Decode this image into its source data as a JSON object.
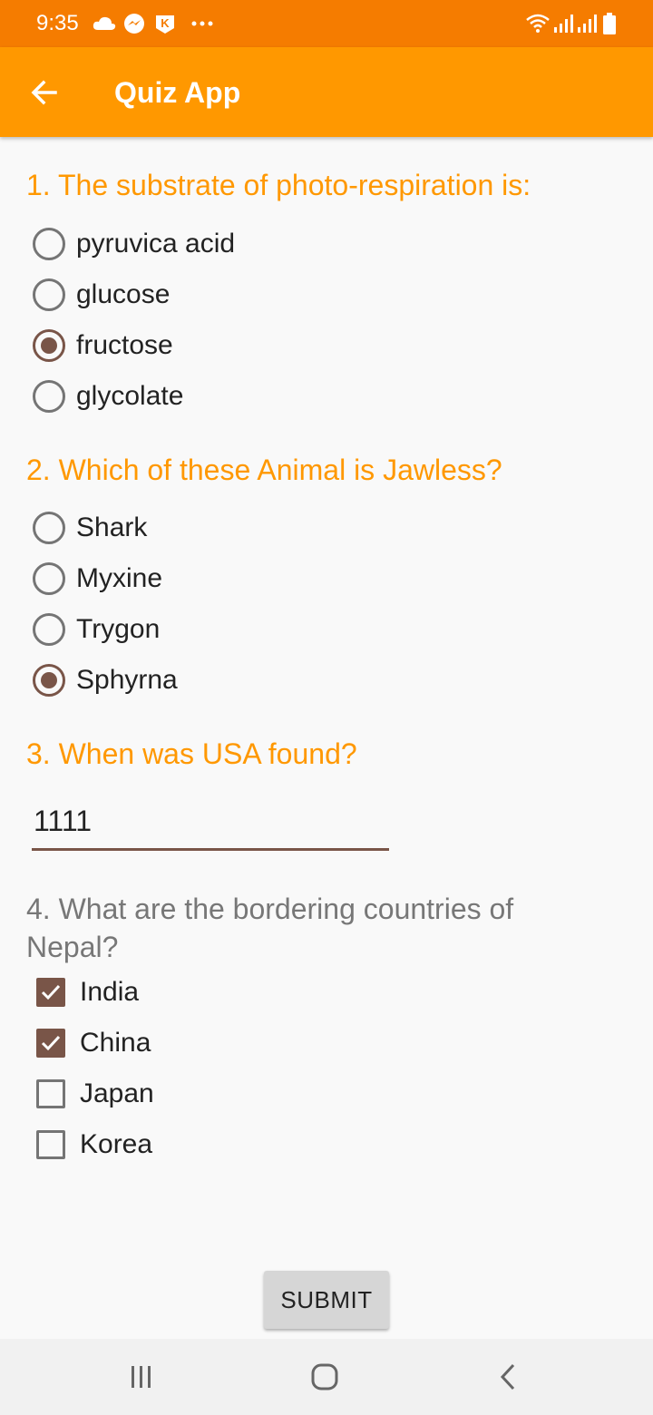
{
  "status_bar": {
    "time": "9:35",
    "left_icons": [
      "cloud-icon",
      "messenger-icon",
      "k-app-icon",
      "more-dots-icon"
    ],
    "right_icons": [
      "wifi-icon",
      "signal-icon",
      "signal-icon",
      "battery-icon"
    ]
  },
  "app_bar": {
    "title": "Quiz App",
    "back_icon": "arrow-left-icon"
  },
  "questions": [
    {
      "text": "1. The substrate of photo-respiration is:",
      "type": "radio",
      "options": [
        {
          "label": "pyruvica acid",
          "selected": false
        },
        {
          "label": "glucose",
          "selected": false
        },
        {
          "label": "fructose",
          "selected": true
        },
        {
          "label": "glycolate",
          "selected": false
        }
      ]
    },
    {
      "text": "2. Which of these Animal is Jawless?",
      "type": "radio",
      "options": [
        {
          "label": "Shark",
          "selected": false
        },
        {
          "label": "Myxine",
          "selected": false
        },
        {
          "label": "Trygon",
          "selected": false
        },
        {
          "label": "Sphyrna",
          "selected": true
        }
      ]
    },
    {
      "text": "3. When was USA found?",
      "type": "text",
      "value": "1111"
    },
    {
      "text_line1": "4. What are the bordering countries of",
      "text_line2": "Nepal?",
      "type": "checkbox",
      "options": [
        {
          "label": "India",
          "checked": true
        },
        {
          "label": "China",
          "checked": true
        },
        {
          "label": "Japan",
          "checked": false
        },
        {
          "label": "Korea",
          "checked": false
        }
      ]
    }
  ],
  "submit_label": "SUBMIT",
  "nav_bar": {
    "icons": [
      "recent-apps-icon",
      "home-icon",
      "back-icon"
    ]
  },
  "colors": {
    "status_bar": "#f57c00",
    "app_bar": "#ff9800",
    "accent": "#795548",
    "question_text": "#ff9800",
    "question_text_gray": "#777777"
  }
}
